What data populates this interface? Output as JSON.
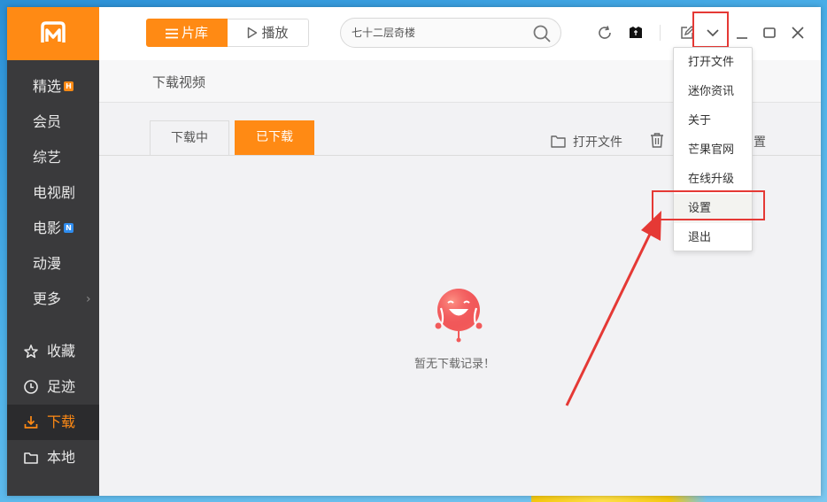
{
  "topbar": {
    "library_label": "片库",
    "play_label": "播放",
    "search_placeholder": "七十二层奇楼"
  },
  "sidebar": {
    "items": [
      {
        "label": "精选",
        "badge": "H"
      },
      {
        "label": "会员"
      },
      {
        "label": "综艺"
      },
      {
        "label": "电视剧"
      },
      {
        "label": "电影",
        "badge": "N"
      },
      {
        "label": "动漫"
      },
      {
        "label": "更多",
        "chevron": "›"
      }
    ],
    "bottom_items": [
      {
        "label": "收藏",
        "icon": "star-icon"
      },
      {
        "label": "足迹",
        "icon": "clock-icon"
      },
      {
        "label": "下载",
        "icon": "download-icon",
        "active": true
      },
      {
        "label": "本地",
        "icon": "folder-icon"
      }
    ]
  },
  "content": {
    "page_title": "下载视频",
    "tabs": [
      "下载中",
      "已下载"
    ],
    "active_tab": 1,
    "open_file_label": "打开文件",
    "settings_partial": "置",
    "empty_text": "暂无下载记录！"
  },
  "menu": {
    "items": [
      "打开文件",
      "迷你资讯",
      "关于",
      "芒果官网",
      "在线升级",
      "设置",
      "退出"
    ],
    "highlighted": "设置"
  },
  "colors": {
    "accent": "#ff8a14",
    "sidebar_bg": "#3a3a3c",
    "annotation_red": "#e53935"
  }
}
